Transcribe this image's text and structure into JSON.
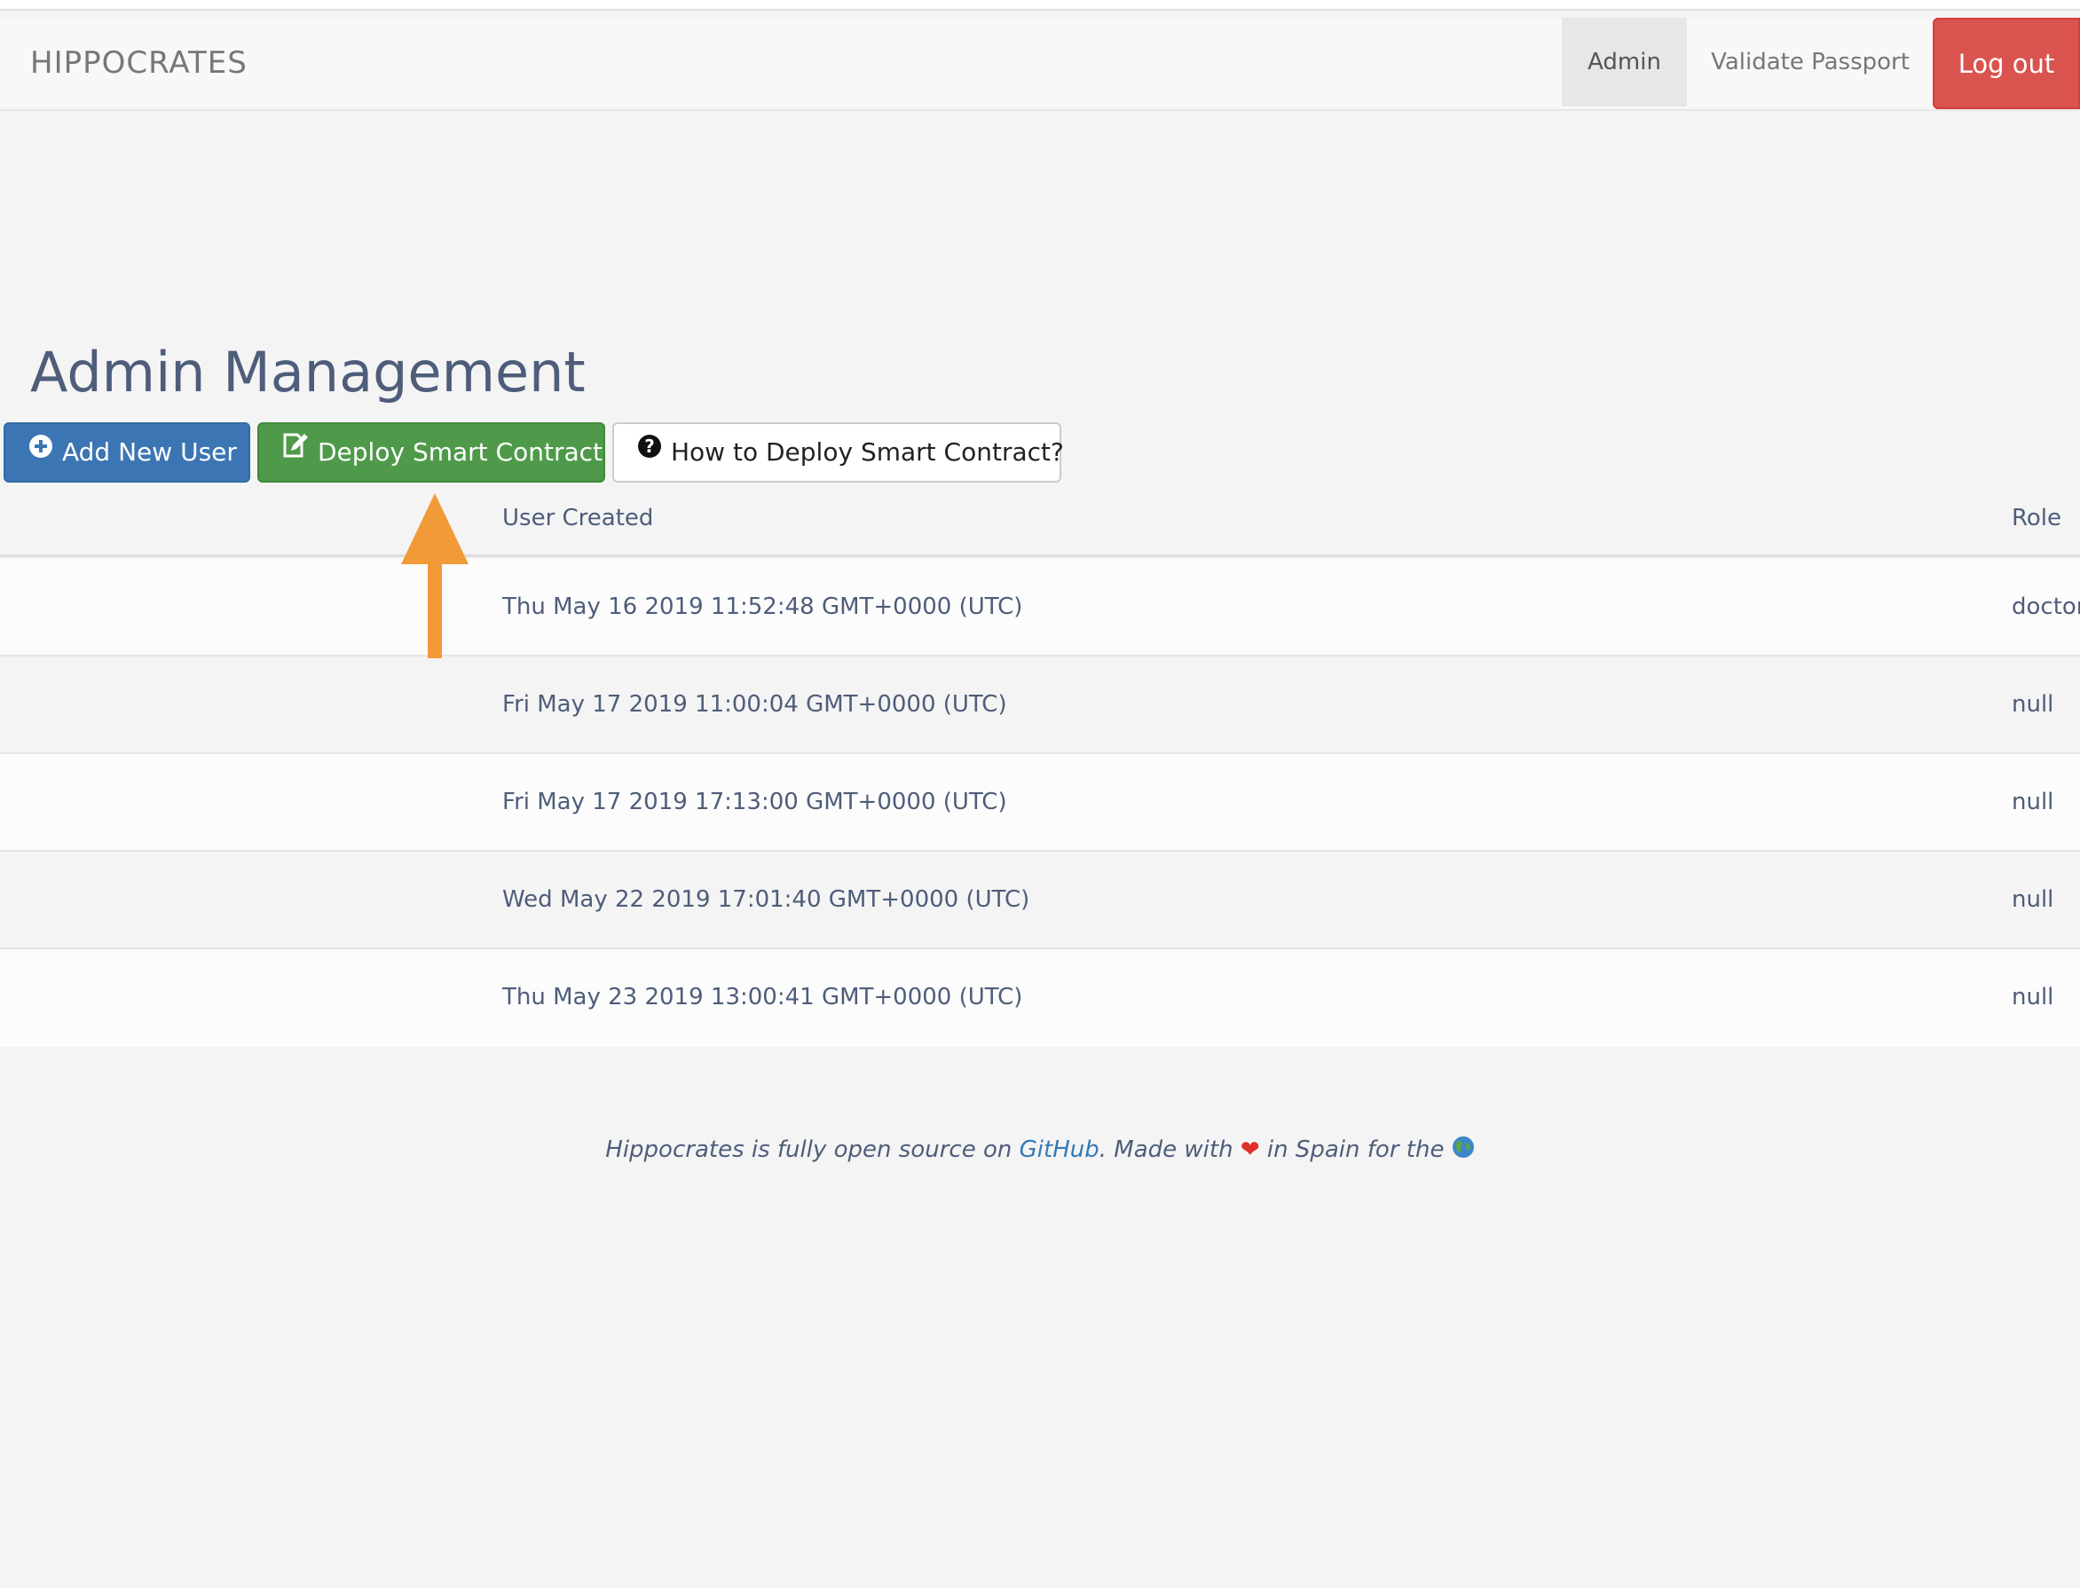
{
  "navbar": {
    "brand": "HIPPOCRATES",
    "items": [
      {
        "label": "Admin"
      },
      {
        "label": "Validate Passport"
      }
    ],
    "logout_label": "Log out"
  },
  "page": {
    "title": "Admin Management"
  },
  "actions": {
    "add_user": "Add New User",
    "deploy_contract": "Deploy Smart Contract",
    "how_to_deploy": "How to Deploy Smart Contract?"
  },
  "table": {
    "headers": {
      "created": "User Created",
      "role": "Role"
    },
    "rows": [
      {
        "created": "Thu May 16 2019 11:52:48 GMT+0000 (UTC)",
        "role": "doctor"
      },
      {
        "created": "Fri May 17 2019 11:00:04 GMT+0000 (UTC)",
        "role": "null"
      },
      {
        "created": "Fri May 17 2019 17:13:00 GMT+0000 (UTC)",
        "role": "null"
      },
      {
        "created": "Wed May 22 2019 17:01:40 GMT+0000 (UTC)",
        "role": "null"
      },
      {
        "created": "Thu May 23 2019 13:00:41 GMT+0000 (UTC)",
        "role": "null"
      }
    ]
  },
  "footer": {
    "text_1": "Hippocrates is fully open source on ",
    "link": "GitHub",
    "text_2": ". Made with ",
    "heart": "❤",
    "text_3": "  in Spain for the "
  },
  "annotation": {
    "color": "#f29a37",
    "icon": "up-arrow-icon"
  }
}
